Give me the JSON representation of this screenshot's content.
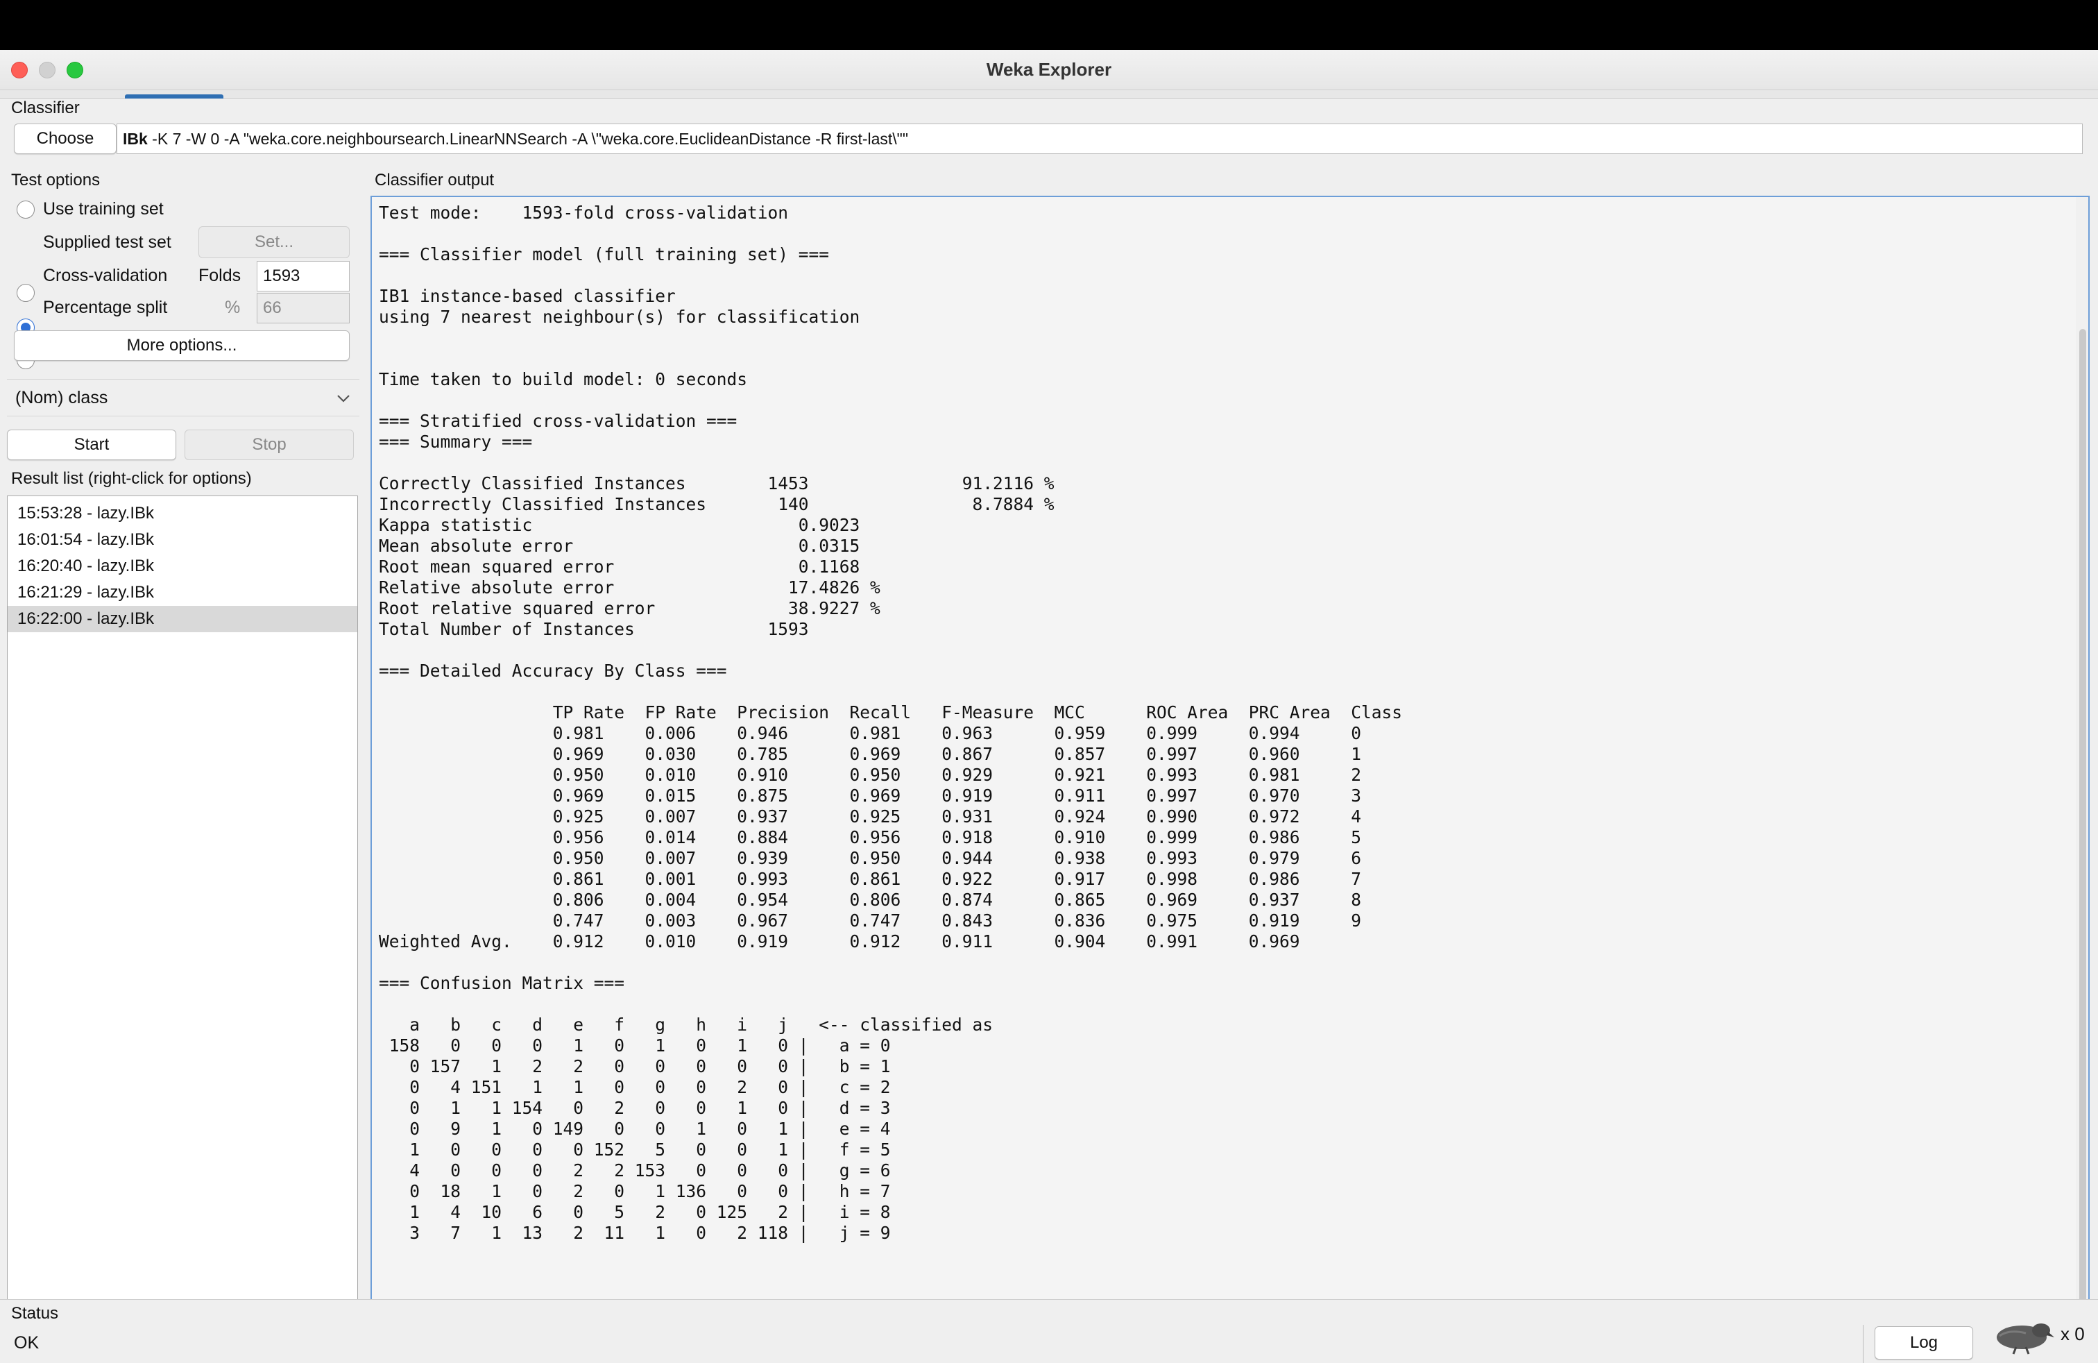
{
  "window": {
    "title": "Weka Explorer"
  },
  "classifier": {
    "section_label": "Classifier",
    "choose_label": "Choose",
    "name": "IBk",
    "options": " -K 7 -W 0 -A \"weka.core.neighboursearch.LinearNNSearch -A \\\"weka.core.EuclideanDistance -R first-last\\\"\""
  },
  "test_options": {
    "section_label": "Test options",
    "use_training_set": "Use training set",
    "supplied_test_set": "Supplied test set",
    "set_button": "Set...",
    "cross_validation": "Cross-validation",
    "folds_label": "Folds",
    "folds_value": "1593",
    "percentage_split": "Percentage split",
    "percent_label": "%",
    "percent_value": "66",
    "more_options": "More options...",
    "selected": "cross_validation"
  },
  "class_select": {
    "value": "(Nom) class"
  },
  "actions": {
    "start": "Start",
    "stop": "Stop"
  },
  "result_list": {
    "label": "Result list (right-click for options)",
    "items": [
      "15:53:28 - lazy.IBk",
      "16:01:54 - lazy.IBk",
      "16:20:40 - lazy.IBk",
      "16:21:29 - lazy.IBk",
      "16:22:00 - lazy.IBk"
    ],
    "selected_index": 4
  },
  "output": {
    "label": "Classifier output",
    "text": "Test mode:    1593-fold cross-validation\n\n=== Classifier model (full training set) ===\n\nIB1 instance-based classifier\nusing 7 nearest neighbour(s) for classification\n\n\nTime taken to build model: 0 seconds\n\n=== Stratified cross-validation ===\n=== Summary ===\n\nCorrectly Classified Instances        1453               91.2116 %\nIncorrectly Classified Instances       140                8.7884 %\nKappa statistic                          0.9023\nMean absolute error                      0.0315\nRoot mean squared error                  0.1168\nRelative absolute error                 17.4826 %\nRoot relative squared error             38.9227 %\nTotal Number of Instances             1593     \n\n=== Detailed Accuracy By Class ===\n\n                 TP Rate  FP Rate  Precision  Recall   F-Measure  MCC      ROC Area  PRC Area  Class\n                 0.981    0.006    0.946      0.981    0.963      0.959    0.999     0.994     0\n                 0.969    0.030    0.785      0.969    0.867      0.857    0.997     0.960     1\n                 0.950    0.010    0.910      0.950    0.929      0.921    0.993     0.981     2\n                 0.969    0.015    0.875      0.969    0.919      0.911    0.997     0.970     3\n                 0.925    0.007    0.937      0.925    0.931      0.924    0.990     0.972     4\n                 0.956    0.014    0.884      0.956    0.918      0.910    0.999     0.986     5\n                 0.950    0.007    0.939      0.950    0.944      0.938    0.993     0.979     6\n                 0.861    0.001    0.993      0.861    0.922      0.917    0.998     0.986     7\n                 0.806    0.004    0.954      0.806    0.874      0.865    0.969     0.937     8\n                 0.747    0.003    0.967      0.747    0.843      0.836    0.975     0.919     9\nWeighted Avg.    0.912    0.010    0.919      0.912    0.911      0.904    0.991     0.969     \n\n=== Confusion Matrix ===\n\n   a   b   c   d   e   f   g   h   i   j   <-- classified as\n 158   0   0   0   1   0   1   0   1   0 |   a = 0\n   0 157   1   2   2   0   0   0   0   0 |   b = 1\n   0   4 151   1   1   0   0   0   2   0 |   c = 2\n   0   1   1 154   0   2   0   0   1   0 |   d = 3\n   0   9   1   0 149   0   0   1   0   1 |   e = 4\n   1   0   0   0   0 152   5   0   0   1 |   f = 5\n   4   0   0   0   2   2 153   0   0   0 |   g = 6\n   0  18   1   0   2   0   1 136   0   0 |   h = 7\n   1   4  10   6   0   5   2   0 125   2 |   i = 8\n   3   7   1  13   2  11   1   0   2 118 |   j = 9"
  },
  "status": {
    "label": "Status",
    "value": "OK",
    "log_button": "Log",
    "count": "x 0"
  }
}
